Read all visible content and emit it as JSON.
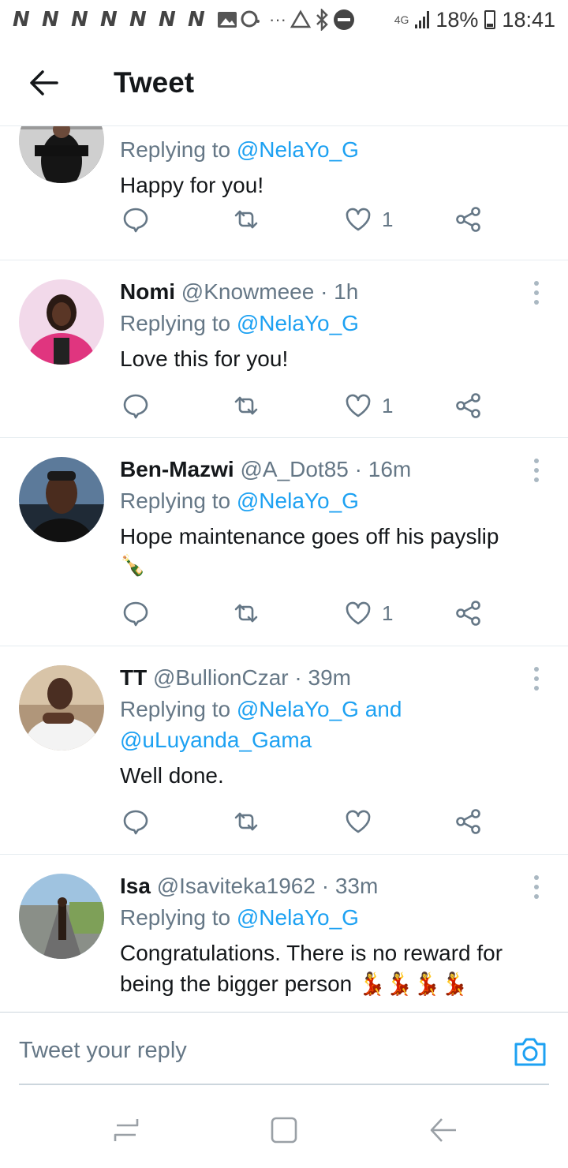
{
  "status_bar": {
    "notifications": [
      "N",
      "N",
      "N",
      "N",
      "N",
      "N",
      "N"
    ],
    "dots": "···",
    "network": "4G",
    "battery": "18%",
    "time": "18:41"
  },
  "header": {
    "title": "Tweet"
  },
  "tweets": [
    {
      "name": "",
      "handle": "",
      "time": "",
      "replying_prefix": "Replying to ",
      "mentions": "@NelaYo_G",
      "mentions_extra": "",
      "text": "Happy for you!",
      "emoji": "",
      "likes": "1"
    },
    {
      "name": "Nomi",
      "handle": "@Knowmeee",
      "time": "· 1h",
      "replying_prefix": "Replying to ",
      "mentions": "@NelaYo_G",
      "mentions_extra": "",
      "text": "Love this for you!",
      "emoji": "",
      "likes": "1"
    },
    {
      "name": "Ben-Mazwi",
      "handle": "@A_Dot85",
      "time": "· 16m",
      "replying_prefix": "Replying to ",
      "mentions": "@NelaYo_G",
      "mentions_extra": "",
      "text": "Hope maintenance goes off his payslip",
      "emoji": "🍾",
      "likes": "1"
    },
    {
      "name": "TT",
      "handle": "@BullionCzar",
      "time": "· 39m",
      "replying_prefix": "Replying to ",
      "mentions": "@NelaYo_G and",
      "mentions_extra": "@uLuyanda_Gama",
      "text": "Well done.",
      "emoji": "",
      "likes": ""
    },
    {
      "name": "Isa",
      "handle": "@Isaviteka1962",
      "time": "· 33m",
      "replying_prefix": "Replying to ",
      "mentions": "@NelaYo_G",
      "mentions_extra": "",
      "text": "Congratulations. There is no reward for being the bigger person",
      "emoji": "💃💃💃💃",
      "likes": ""
    }
  ],
  "reply_bar": {
    "placeholder": "Tweet your reply"
  },
  "colors": {
    "accent": "#1da1f2",
    "secondary_text": "#657786",
    "divider": "#e6ecf0"
  }
}
